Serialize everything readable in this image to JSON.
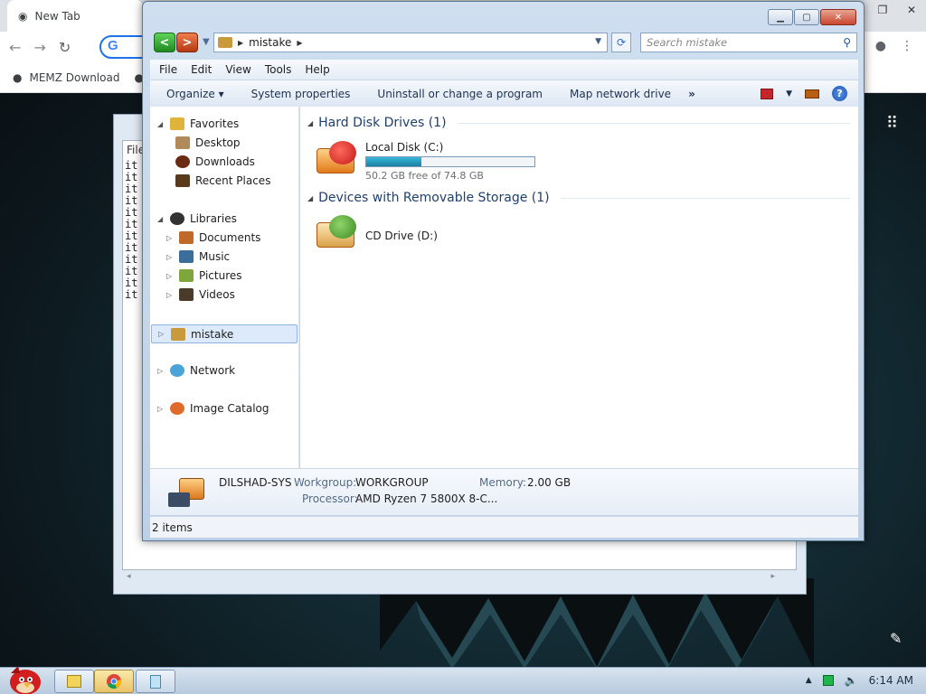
{
  "chrome": {
    "tab_title": "New Tab",
    "bookmark": "MEMZ Download"
  },
  "notepad": {
    "menu_partial": "File",
    "lines": [
      "it",
      "it",
      "it",
      "it",
      "it",
      "it",
      "it",
      "it",
      "it",
      "it",
      "it",
      "it"
    ]
  },
  "explorer": {
    "address": {
      "path": "mistake"
    },
    "search": {
      "placeholder": "Search mistake"
    },
    "menu": [
      "File",
      "Edit",
      "View",
      "Tools",
      "Help"
    ],
    "commands": {
      "organize": "Organize",
      "system_properties": "System properties",
      "uninstall": "Uninstall or change a program",
      "map_network": "Map network drive",
      "more": "»"
    },
    "navpane": {
      "favorites": "Favorites",
      "favorites_items": [
        "Desktop",
        "Downloads",
        "Recent Places"
      ],
      "libraries": "Libraries",
      "libraries_items": [
        "Documents",
        "Music",
        "Pictures",
        "Videos"
      ],
      "computer": "mistake",
      "network": "Network",
      "image_catalog": "Image Catalog"
    },
    "groups": {
      "hdd": "Hard Disk Drives (1)",
      "removable": "Devices with Removable Storage (1)"
    },
    "drives": {
      "c": {
        "name": "Local Disk (C:)",
        "free": "50.2 GB free of 74.8 GB",
        "used_fraction": 0.33
      },
      "d": {
        "name": "CD Drive (D:)"
      }
    },
    "details": {
      "computer_name": "DILSHAD-SYS",
      "workgroup_label": "Workgroup:",
      "workgroup": "WORKGROUP",
      "memory_label": "Memory:",
      "memory": "2.00 GB",
      "processor_label": "Processor:",
      "processor": "AMD Ryzen 7 5800X 8-C..."
    },
    "status": "2 items"
  },
  "taskbar": {
    "time": "6:14 AM"
  }
}
